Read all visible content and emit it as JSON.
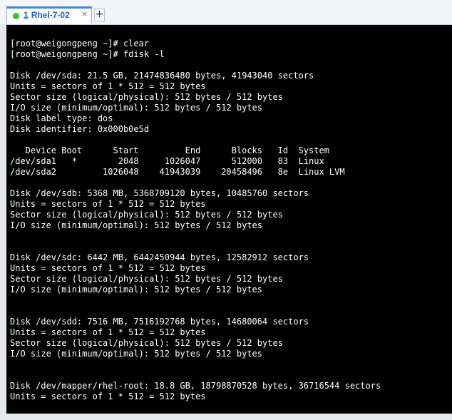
{
  "tab": {
    "number": "1",
    "title": "Rhel-7-02",
    "close_glyph": "×",
    "new_tab_glyph": "+",
    "status_color": "#3bbf3b"
  },
  "terminal": {
    "lines": [
      "[root@weigongpeng ~]# clear",
      "[root@weigongpeng ~]# fdisk -l",
      "",
      "Disk /dev/sda: 21.5 GB, 21474836480 bytes, 41943040 sectors",
      "Units = sectors of 1 * 512 = 512 bytes",
      "Sector size (logical/physical): 512 bytes / 512 bytes",
      "I/O size (minimum/optimal): 512 bytes / 512 bytes",
      "Disk label type: dos",
      "Disk identifier: 0x000b0e5d",
      "",
      "   Device Boot      Start         End      Blocks   Id  System",
      "/dev/sda1   *        2048     1026047      512000   83  Linux",
      "/dev/sda2         1026048    41943039    20458496   8e  Linux LVM",
      "",
      "Disk /dev/sdb: 5368 MB, 5368709120 bytes, 10485760 sectors",
      "Units = sectors of 1 * 512 = 512 bytes",
      "Sector size (logical/physical): 512 bytes / 512 bytes",
      "I/O size (minimum/optimal): 512 bytes / 512 bytes",
      "",
      "",
      "Disk /dev/sdc: 6442 MB, 6442450944 bytes, 12582912 sectors",
      "Units = sectors of 1 * 512 = 512 bytes",
      "Sector size (logical/physical): 512 bytes / 512 bytes",
      "I/O size (minimum/optimal): 512 bytes / 512 bytes",
      "",
      "",
      "Disk /dev/sdd: 7516 MB, 7516192768 bytes, 14680064 sectors",
      "Units = sectors of 1 * 512 = 512 bytes",
      "Sector size (logical/physical): 512 bytes / 512 bytes",
      "I/O size (minimum/optimal): 512 bytes / 512 bytes",
      "",
      "",
      "Disk /dev/mapper/rhel-root: 18.8 GB, 18798870528 bytes, 36716544 sectors",
      "Units = sectors of 1 * 512 = 512 bytes"
    ]
  }
}
